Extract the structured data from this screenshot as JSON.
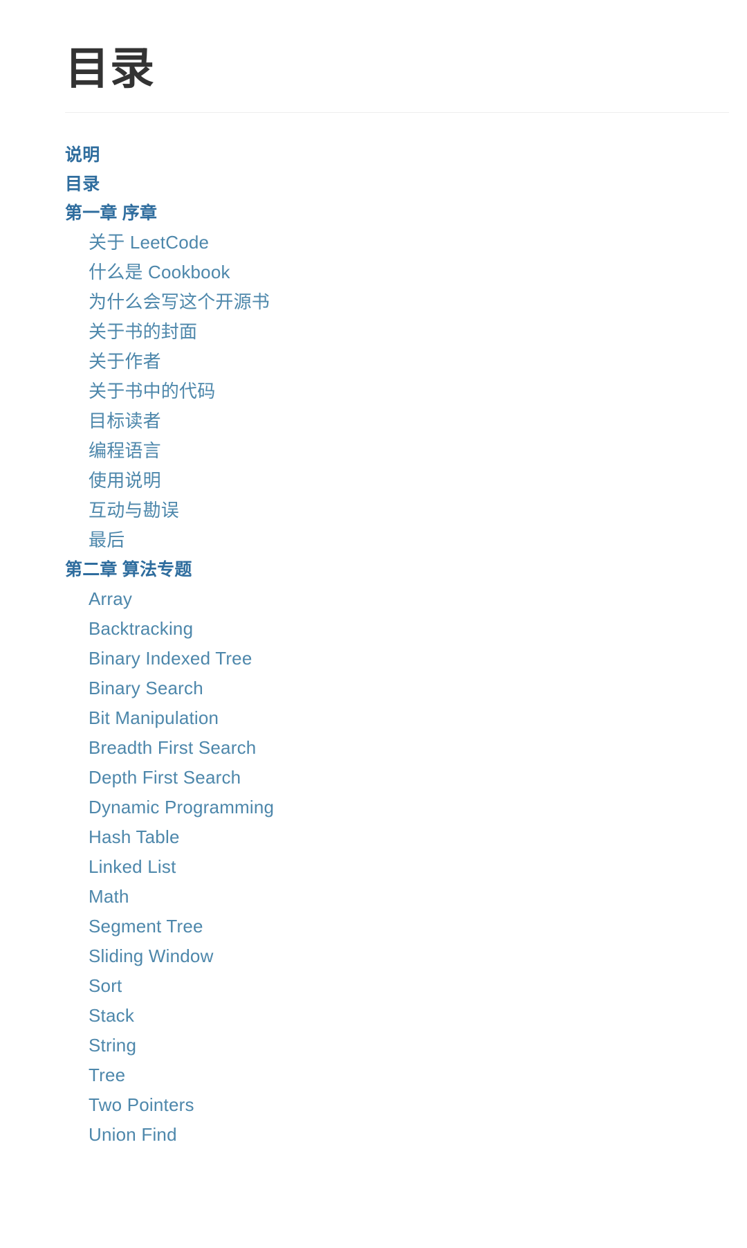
{
  "page": {
    "title": "目录",
    "background_color": "#ffffff",
    "title_color": "#333333",
    "rule_color": "#ededed",
    "level1_link_color": "#2f6d9e",
    "level2_link_color": "#4d87ab"
  },
  "toc": {
    "entries": [
      {
        "label": "说明",
        "level": 1
      },
      {
        "label": "目录",
        "level": 1
      },
      {
        "label": "第一章 序章",
        "level": 1
      },
      {
        "label": "关于 LeetCode",
        "level": 2
      },
      {
        "label": "什么是 Cookbook",
        "level": 2
      },
      {
        "label": "为什么会写这个开源书",
        "level": 2
      },
      {
        "label": "关于书的封面",
        "level": 2
      },
      {
        "label": "关于作者",
        "level": 2
      },
      {
        "label": "关于书中的代码",
        "level": 2
      },
      {
        "label": "目标读者",
        "level": 2
      },
      {
        "label": "编程语言",
        "level": 2
      },
      {
        "label": "使用说明",
        "level": 2
      },
      {
        "label": "互动与勘误",
        "level": 2
      },
      {
        "label": "最后",
        "level": 2
      },
      {
        "label": "第二章 算法专题",
        "level": 1
      },
      {
        "label": "Array",
        "level": 2
      },
      {
        "label": "Backtracking",
        "level": 2
      },
      {
        "label": "Binary Indexed Tree",
        "level": 2
      },
      {
        "label": "Binary Search",
        "level": 2
      },
      {
        "label": "Bit Manipulation",
        "level": 2
      },
      {
        "label": "Breadth First Search",
        "level": 2
      },
      {
        "label": "Depth First Search",
        "level": 2
      },
      {
        "label": "Dynamic Programming",
        "level": 2
      },
      {
        "label": "Hash Table",
        "level": 2
      },
      {
        "label": "Linked List",
        "level": 2
      },
      {
        "label": "Math",
        "level": 2
      },
      {
        "label": "Segment Tree",
        "level": 2
      },
      {
        "label": "Sliding Window",
        "level": 2
      },
      {
        "label": "Sort",
        "level": 2
      },
      {
        "label": "Stack",
        "level": 2
      },
      {
        "label": "String",
        "level": 2
      },
      {
        "label": "Tree",
        "level": 2
      },
      {
        "label": "Two Pointers",
        "level": 2
      },
      {
        "label": "Union Find",
        "level": 2
      }
    ]
  }
}
